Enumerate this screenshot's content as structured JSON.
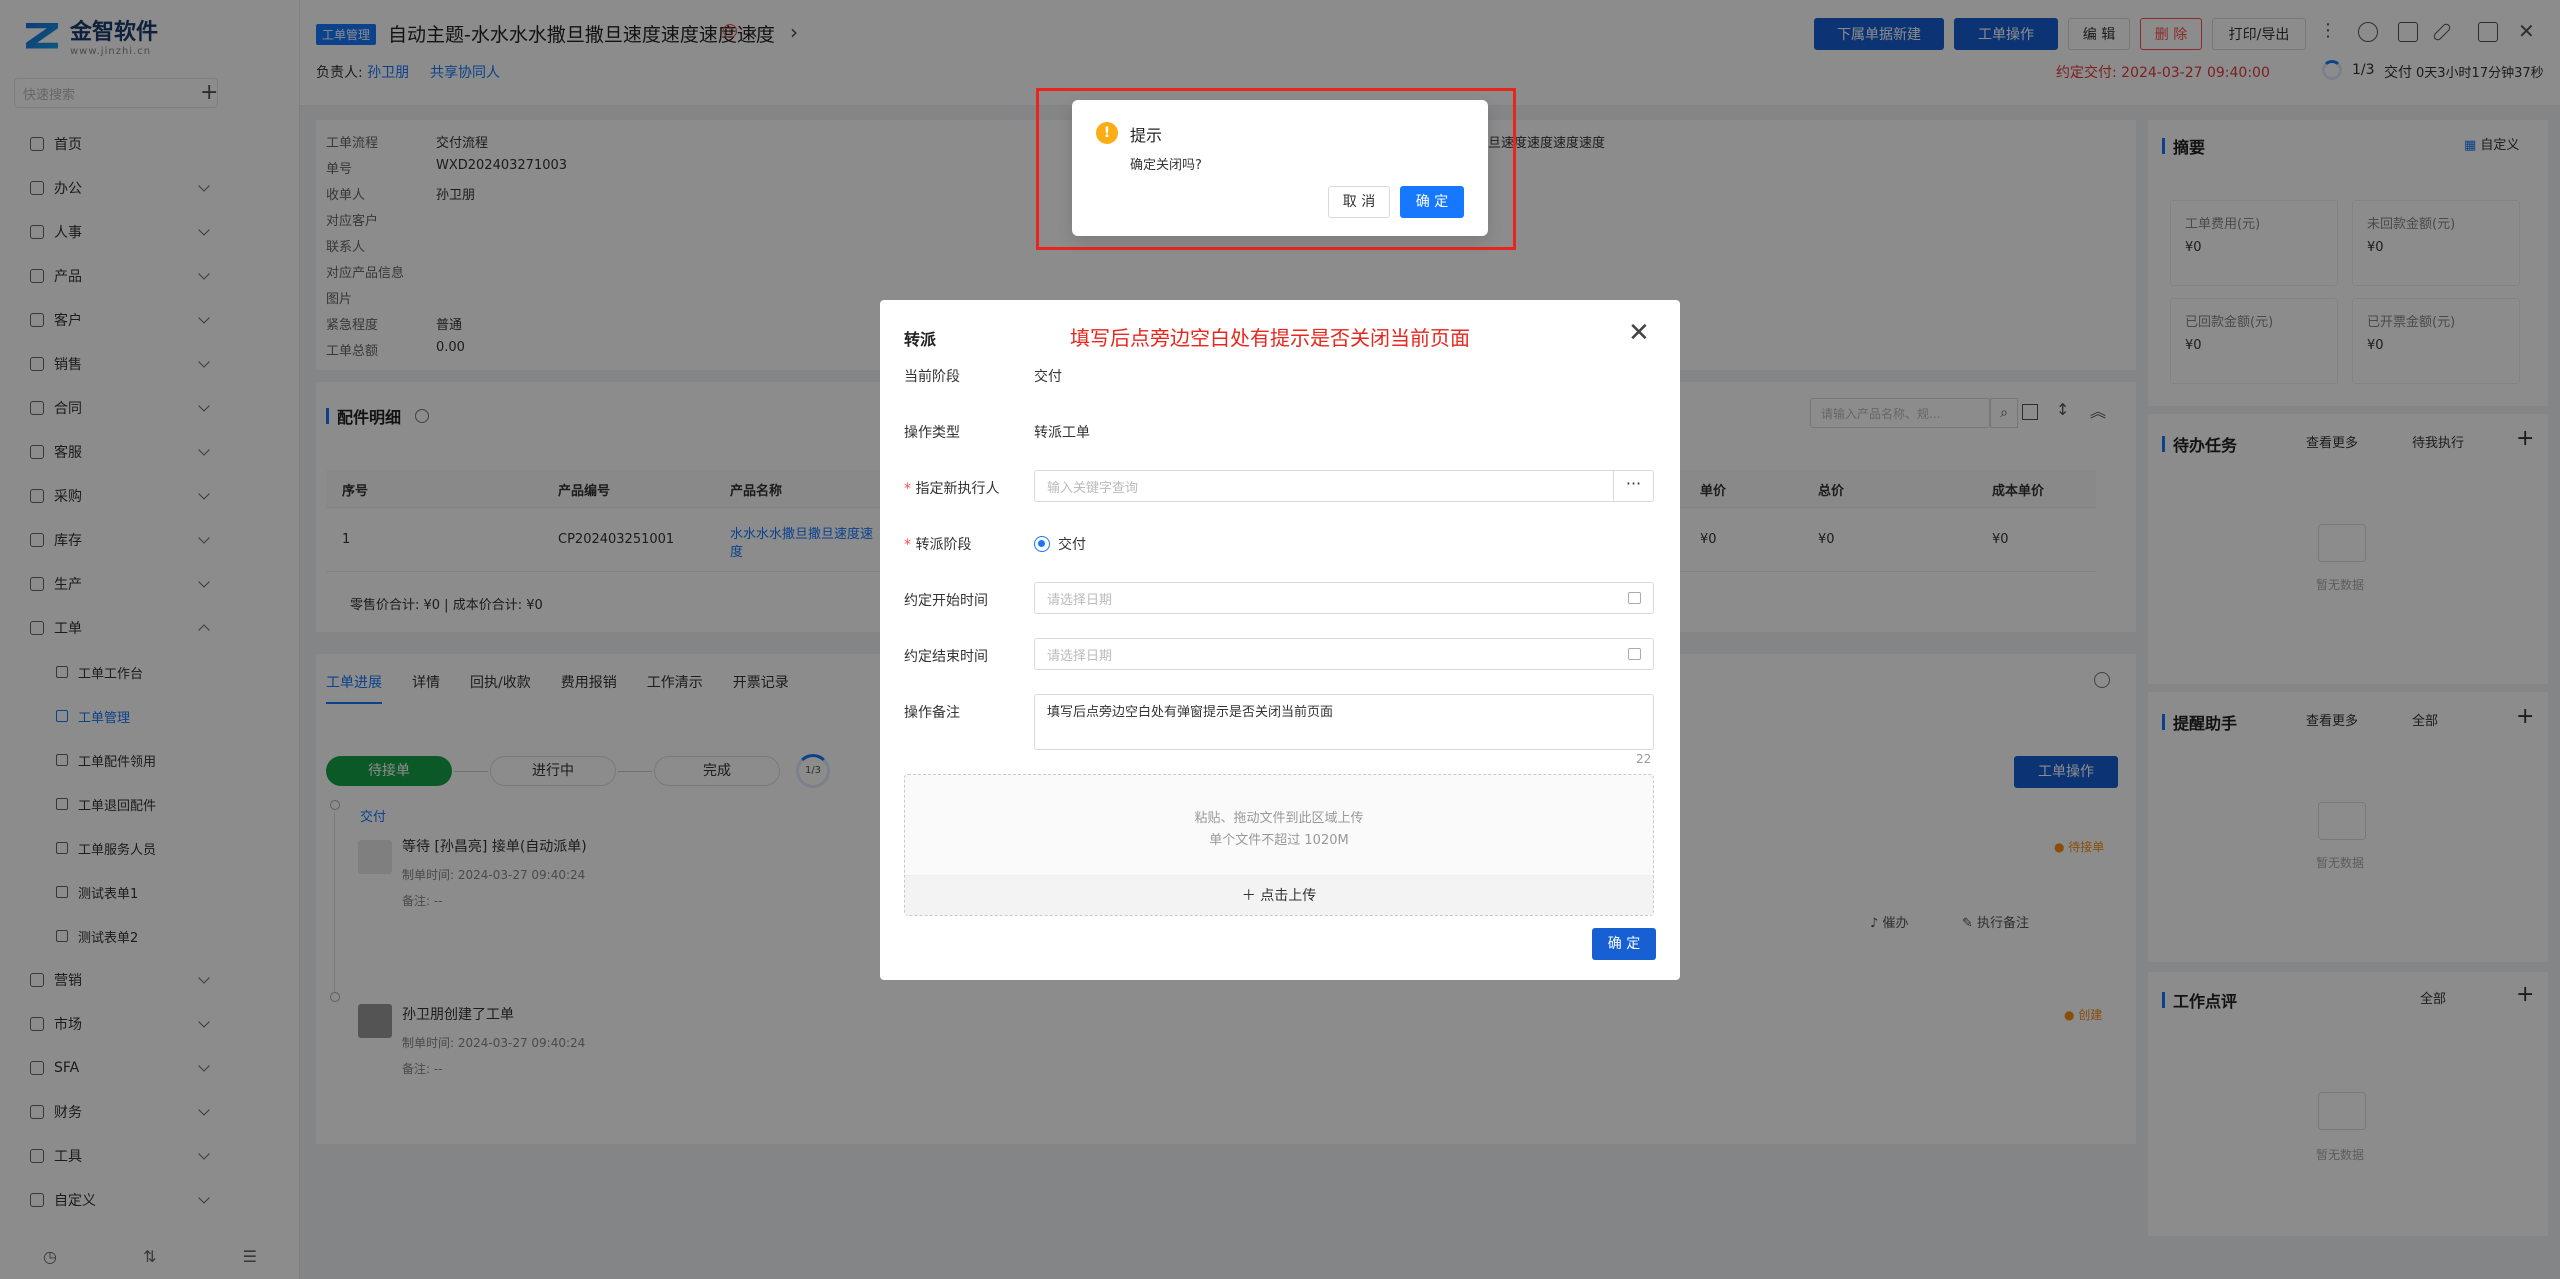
{
  "app": {
    "logo_name": "金智软件",
    "logo_sub": "www.jinzhi.cn",
    "search_placeholder": "快速搜索",
    "plus": "+"
  },
  "menu": [
    {
      "label": "首页"
    },
    {
      "label": "办公"
    },
    {
      "label": "人事"
    },
    {
      "label": "产品"
    },
    {
      "label": "客户"
    },
    {
      "label": "销售"
    },
    {
      "label": "合同"
    },
    {
      "label": "客服"
    },
    {
      "label": "采购"
    },
    {
      "label": "库存"
    },
    {
      "label": "生产"
    },
    {
      "label": "工单"
    }
  ],
  "submenu": [
    {
      "label": "工单工作台"
    },
    {
      "label": "工单管理"
    },
    {
      "label": "工单配件领用"
    },
    {
      "label": "工单退回配件"
    },
    {
      "label": "工单服务人员"
    },
    {
      "label": "测试表单1"
    },
    {
      "label": "测试表单2"
    }
  ],
  "menu2": [
    {
      "label": "营销"
    },
    {
      "label": "市场"
    },
    {
      "label": "SFA"
    },
    {
      "label": "财务"
    },
    {
      "label": "工具"
    },
    {
      "label": "自定义"
    }
  ],
  "header": {
    "tag": "工单管理",
    "title": "自动主题-水水水水撒旦撒旦速度速度速度速度",
    "alert_icon": "!",
    "prev": "‹",
    "next": "›",
    "owner_label": "负责人:",
    "owner": "孙卫朋",
    "share": "共享协同人",
    "btn_more_new": "下属单据新建",
    "btn_ops": "工单操作",
    "btn_edit": "编 辑",
    "btn_delete": "删 除",
    "btn_print": "打印/导出",
    "deadline": "约定交付: 2024-03-27 09:40:00",
    "progress": "1/3",
    "stage": "交付",
    "elapsed": "0天3小时17分钟37秒"
  },
  "info": {
    "rows": [
      {
        "k": "工单流程",
        "v": "交付流程"
      },
      {
        "k": "单号",
        "v": "WXD202403271003"
      },
      {
        "k": "收单人",
        "v": "孙卫朋"
      },
      {
        "k": "对应客户",
        "v": ""
      },
      {
        "k": "联系人",
        "v": ""
      },
      {
        "k": "对应产品信息",
        "v": ""
      },
      {
        "k": "图片",
        "v": ""
      },
      {
        "k": "紧急程度",
        "v": "普通"
      },
      {
        "k": "工单总额",
        "v": "0.00"
      }
    ],
    "subject_tail": "旦速度速度速度速度"
  },
  "parts": {
    "title": "配件明细",
    "search_placeholder": "请输入产品名称、规...",
    "cols": [
      "序号",
      "产品编号",
      "产品名称",
      "单价",
      "总价",
      "成本单价"
    ],
    "row": {
      "no": "1",
      "code": "CP202403251001",
      "name": "水水水水撒旦撒旦速度速度",
      "price": "¥0",
      "total": "¥0",
      "cost": "¥0"
    },
    "sum": "零售价合计: ¥0 |  成本价合计: ¥0"
  },
  "tabs": [
    "工单进展",
    "详情",
    "回执/收款",
    "费用报销",
    "工作清示",
    "开票记录"
  ],
  "steps": {
    "s1": "待接单",
    "s2": "进行中",
    "s3": "完成",
    "ring": "1/3",
    "ops": "工单操作"
  },
  "timeline": [
    {
      "stage": "交付",
      "title": "等待 [孙昌亮] 接单(自动派单)",
      "time": "制单时间: 2024-03-27 09:40:24",
      "note": "备注: --",
      "status": "● 待接单",
      "a1": "催办",
      "a2": "执行备注"
    },
    {
      "title": "孙卫朋创建了工单",
      "time": "制单时间: 2024-03-27 09:40:24",
      "note": "备注: --",
      "status": "● 创建"
    }
  ],
  "right": {
    "summary_title": "摘要",
    "custom": "自定义",
    "stats": [
      {
        "k": "工单费用(元)",
        "v": "¥0"
      },
      {
        "k": "未回款金额(元)",
        "v": "¥0"
      },
      {
        "k": "已回款金额(元)",
        "v": "¥0"
      },
      {
        "k": "已开票金额(元)",
        "v": "¥0"
      }
    ],
    "todo_title": "待办任务",
    "todo_more": "查看更多",
    "todo_filter": "待我执行",
    "remind_title": "提醒助手",
    "remind_more": "查看更多",
    "remind_filter": "全部",
    "review_title": "工作点评",
    "review_filter": "全部",
    "empty": "暂无数据"
  },
  "dialog": {
    "title": "转派",
    "annotation": "填写后点旁边空白处有提示是否关闭当前页面",
    "close": "✕",
    "f_stage_label": "当前阶段",
    "f_stage": "交付",
    "f_type_label": "操作类型",
    "f_type": "转派工单",
    "f_exec_label": "指定新执行人",
    "f_exec_ph": "输入关键字查询",
    "more": "···",
    "f_to_label": "转派阶段",
    "f_to": "交付",
    "f_start_label": "约定开始时间",
    "f_start_ph": "请选择日期",
    "f_end_label": "约定结束时间",
    "f_end_ph": "请选择日期",
    "f_note_label": "操作备注",
    "f_note": "填写后点旁边空白处有弹窗提示是否关闭当前页面",
    "f_note_count": "22",
    "up1": "粘贴、拖动文件到此区域上传",
    "up2": "单个文件不超过 1020M",
    "up_btn": "＋ 点击上传",
    "ok": "确 定"
  },
  "confirm": {
    "icon": "!",
    "title": "提示",
    "msg": "确定关闭吗?",
    "cancel": "取 消",
    "ok": "确 定"
  }
}
